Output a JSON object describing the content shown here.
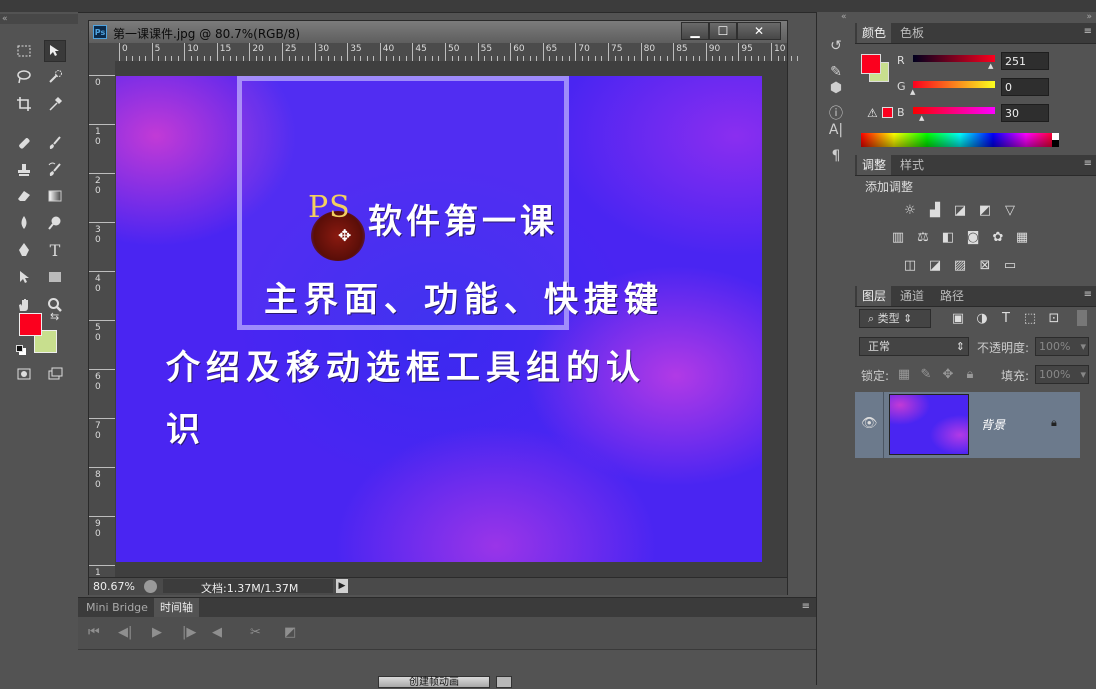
{
  "colors": {
    "foreground": "#fb001e",
    "background": "#c8df8e",
    "layer_selected": "#6c7a8c"
  },
  "document": {
    "title": "第一课课件.jpg @ 80.7%(RGB/8)",
    "ps_badge": "Ps",
    "buttons": {
      "minimize": "▁",
      "maximize": "☐",
      "close": "✕"
    },
    "ruler_h": [
      "0",
      "5",
      "10",
      "15",
      "20",
      "25",
      "30",
      "35",
      "40",
      "45",
      "50",
      "55",
      "60",
      "65",
      "70",
      "75",
      "80",
      "85",
      "90",
      "95",
      "10"
    ],
    "ruler_v": [
      "0",
      "1\n0",
      "2\n0",
      "3\n0",
      "4\n0",
      "5\n0",
      "6\n0",
      "7\n0",
      "8\n0",
      "9\n0",
      "1"
    ],
    "canvas": {
      "ps_text": "PS",
      "line1": "软件第一课",
      "line2": "主界面、功能、快捷键",
      "line3": "介绍及移动选框工具组的认",
      "line4": "识"
    },
    "status": {
      "zoom": "80.67%",
      "doc_size": "文档:1.37M/1.37M",
      "arrow": "▶"
    }
  },
  "bottom_panel": {
    "tabs": [
      "Mini Bridge",
      "时间轴"
    ],
    "controls": [
      "⏮",
      "◀|",
      "▶",
      "|▶",
      "◀"
    ],
    "create_button": "创建帧动画"
  },
  "color_panel": {
    "tabs": [
      "颜色",
      "色板"
    ],
    "channels": [
      {
        "label": "R",
        "value": "251"
      },
      {
        "label": "G",
        "value": "0"
      },
      {
        "label": "B",
        "value": "30"
      }
    ]
  },
  "adjust_panel": {
    "tabs": [
      "调整",
      "样式"
    ],
    "heading": "添加调整"
  },
  "layers_panel": {
    "tabs": [
      "图层",
      "通道",
      "路径"
    ],
    "filter_label": "类型",
    "blend_mode": "正常",
    "opacity_label": "不透明度:",
    "opacity_value": "100%",
    "lock_label": "锁定:",
    "fill_label": "填充:",
    "fill_value": "100%",
    "layer_name": "背景"
  }
}
